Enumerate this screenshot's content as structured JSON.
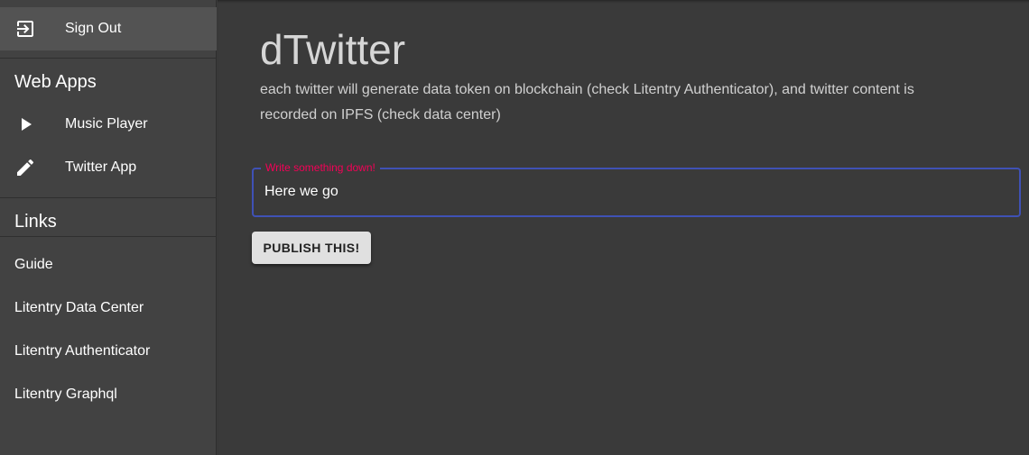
{
  "sidebar": {
    "account": {
      "sign_out_label": "Sign Out",
      "sign_out_icon": "exit-to-app-icon"
    },
    "web_apps": {
      "header": "Web Apps",
      "items": [
        {
          "label": "Music Player",
          "icon": "play-arrow-icon"
        },
        {
          "label": "Twitter App",
          "icon": "edit-pencil-icon"
        }
      ]
    },
    "links": {
      "header": "Links",
      "items": [
        {
          "label": "Guide"
        },
        {
          "label": "Litentry Data Center"
        },
        {
          "label": "Litentry Authenticator"
        },
        {
          "label": "Litentry Graphql"
        }
      ]
    }
  },
  "main": {
    "title": "dTwitter",
    "description": "each twitter will generate data token on blockchain (check Litentry Authenticator), and twitter content is recorded on IPFS (check data center)",
    "input": {
      "label": "Write something down!",
      "value": "Here we go"
    },
    "publish_label": "PUBLISH THIS!"
  },
  "colors": {
    "background": "#3a3a3a",
    "sidebar": "#424242",
    "accent_border": "#3f51b5",
    "label_pink": "#f50057",
    "button_bg": "#e0e0e0"
  }
}
